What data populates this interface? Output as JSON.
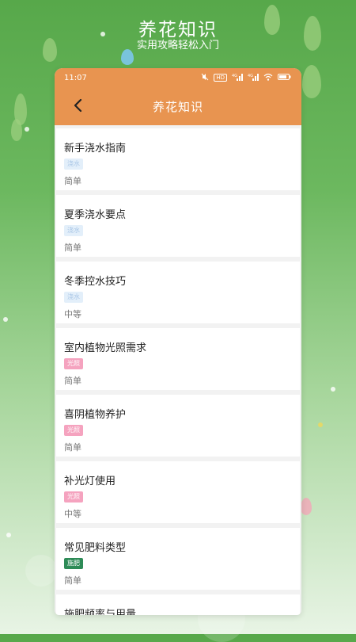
{
  "promo": {
    "title": "养花知识",
    "subtitle": "实用攻略轻松入门"
  },
  "status_bar": {
    "time": "11:07",
    "icons": [
      "mute-icon",
      "hd-icon",
      "signal-4g-icon",
      "signal-4g-icon",
      "wifi-icon",
      "battery-icon"
    ]
  },
  "nav": {
    "title": "养花知识",
    "back_icon": "back-arrow-icon"
  },
  "colors": {
    "header": "#e89450",
    "tag_water": "#e3effa",
    "tag_light": "#f5a3bf",
    "tag_fert": "#2e8b57"
  },
  "items": [
    {
      "title": "新手浇水指南",
      "tag": "浇水",
      "level": "简单"
    },
    {
      "title": "夏季浇水要点",
      "tag": "浇水",
      "level": "简单"
    },
    {
      "title": "冬季控水技巧",
      "tag": "浇水",
      "level": "中等"
    },
    {
      "title": "室内植物光照需求",
      "tag": "光照",
      "level": "简单"
    },
    {
      "title": "喜阴植物养护",
      "tag": "光照",
      "level": "简单"
    },
    {
      "title": "补光灯使用",
      "tag": "光照",
      "level": "中等"
    },
    {
      "title": "常见肥料类型",
      "tag": "施肥",
      "level": "简单"
    },
    {
      "title": "施肥频率与用量"
    }
  ]
}
